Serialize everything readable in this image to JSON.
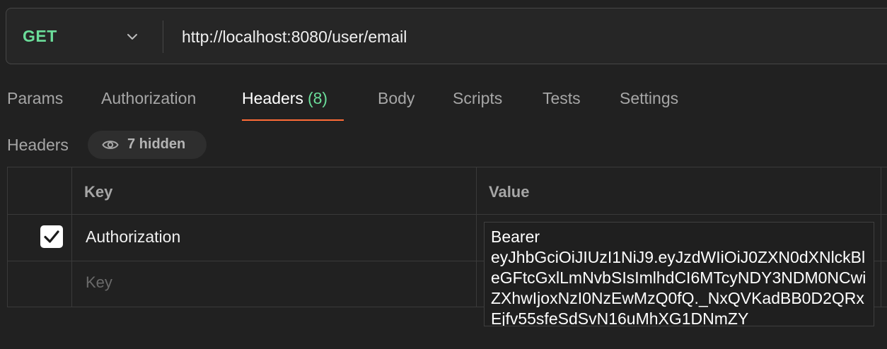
{
  "request": {
    "method": "GET",
    "url": "http://localhost:8080/user/email"
  },
  "tabs": [
    {
      "label": "Params"
    },
    {
      "label": "Authorization"
    },
    {
      "label": "Headers",
      "count": "(8)",
      "active": true
    },
    {
      "label": "Body"
    },
    {
      "label": "Scripts"
    },
    {
      "label": "Tests"
    },
    {
      "label": "Settings"
    }
  ],
  "headers_section": {
    "title": "Headers",
    "hidden_label": "7 hidden",
    "columns": {
      "key": "Key",
      "value": "Value"
    },
    "rows": [
      {
        "checked": true,
        "key": "Authorization",
        "value": "Bearer\neyJhbGciOiJIUzI1NiJ9.eyJzdWIiOiJ0ZXN0dXNlckBleGFtcGxlLmNvbSIsImlhdCI6MTcyNDY3NDM0NCwiZXhwIjoxNzI0NzEwMzQ0fQ._NxQVKadBB0D2QRxEjfv55sfeSdSvN16uMhXG1DNmZY"
      }
    ],
    "new_row_key_placeholder": "Key"
  },
  "colors": {
    "background": "#212121",
    "method_get": "#6bdd9a",
    "active_tab_underline": "#ff6c37"
  },
  "icons": {
    "method_dropdown": "chevron-down-icon",
    "hidden_toggle": "eye-icon",
    "row_checkbox": "checkmark-icon"
  }
}
